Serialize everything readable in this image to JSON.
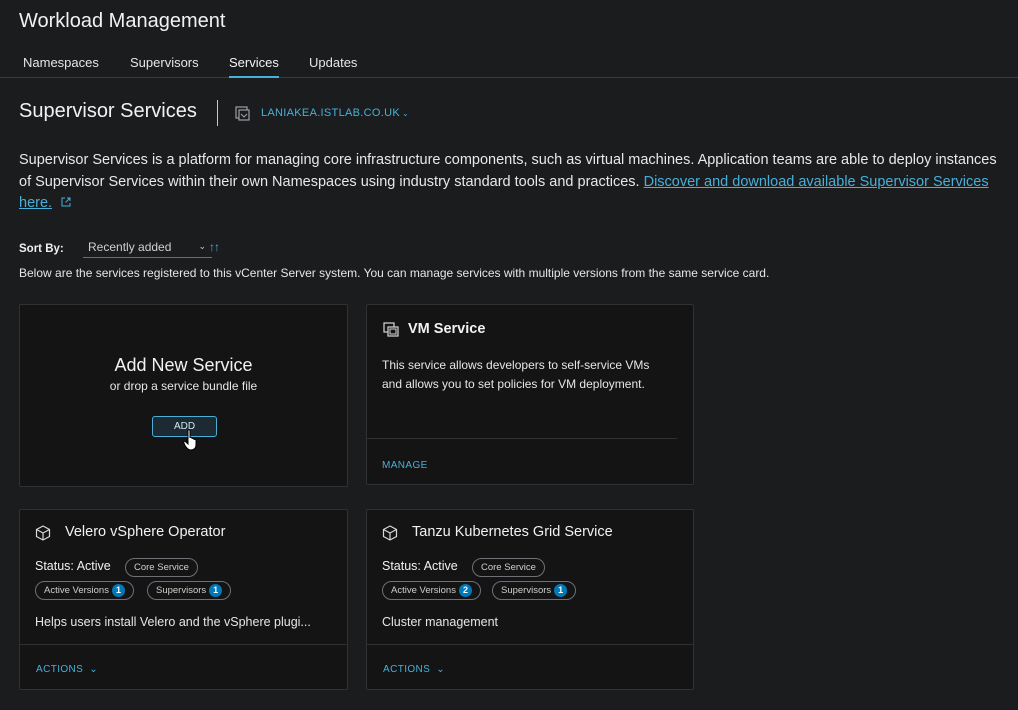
{
  "app": {
    "title": "Workload Management"
  },
  "tabs": [
    {
      "label": "Namespaces",
      "active": false
    },
    {
      "label": "Supervisors",
      "active": false
    },
    {
      "label": "Services",
      "active": true
    },
    {
      "label": "Updates",
      "active": false
    }
  ],
  "page": {
    "title": "Supervisor Services",
    "vcenter": "LANIAKEA.ISTLAB.CO.UK",
    "description": "Supervisor Services is a platform for managing core infrastructure components, such as virtual machines. Application teams are able to deploy instances of Supervisor Services within their own Namespaces using industry standard tools and practices.",
    "description_link": "Discover and download available Supervisor Services here.",
    "sort_label": "Sort By:",
    "sort_value": "Recently added",
    "sort_direction_icon": "sort-arrows-icon",
    "info": "Below are the services registered to this vCenter Server system. You can manage services with multiple versions from the same service card."
  },
  "add_card": {
    "title": "Add New Service",
    "subtitle": "or drop a service bundle file",
    "button": "ADD"
  },
  "vm_card": {
    "title": "VM Service",
    "icon": "vm-service-icon",
    "description": "This service allows developers to self-service VMs and allows you to set policies for VM deployment.",
    "link": "MANAGE"
  },
  "services": [
    {
      "title": "Velero vSphere Operator",
      "icon": "cube-icon",
      "status": "Status: Active",
      "core_badge": "Core Service",
      "active_versions_label": "Active Versions",
      "active_versions_count": "1",
      "supervisors_label": "Supervisors",
      "supervisors_count": "1",
      "description": "Helps users install Velero and the vSphere plugi...",
      "actions": "ACTIONS"
    },
    {
      "title": "Tanzu Kubernetes Grid Service",
      "icon": "cube-icon",
      "status": "Status: Active",
      "core_badge": "Core Service",
      "active_versions_label": "Active Versions",
      "active_versions_count": "2",
      "supervisors_label": "Supervisors",
      "supervisors_count": "1",
      "description": "Cluster management",
      "actions": "ACTIONS"
    }
  ],
  "colors": {
    "accent": "#49afd9",
    "badge": "#0079b8",
    "background": "#1b1c1e",
    "card": "#141415"
  }
}
